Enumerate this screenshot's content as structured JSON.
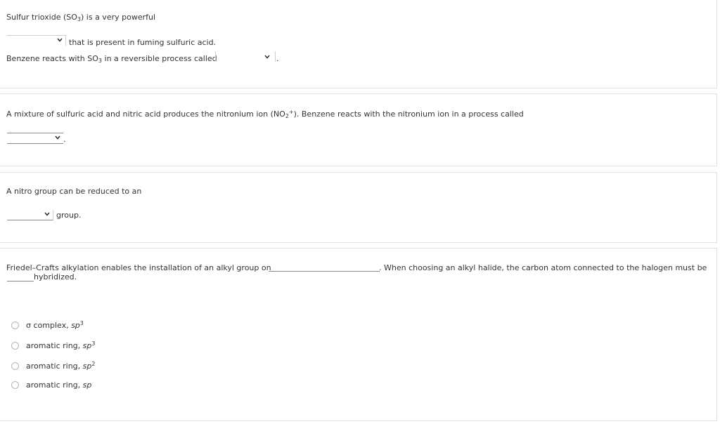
{
  "q1": {
    "line1_text": "Sulfur trioxide (SO",
    "line1_sub": "3",
    "line1_tail": ") is a very powerful",
    "after_dropdown1": "that is present in fuming sulfuric acid.",
    "line3_pre": "Benzene reacts with SO",
    "line3_sub": "3",
    "line3_post": " in a reversible process called",
    "line3_end": "."
  },
  "q2": {
    "text_pre": "A mixture of sulfuric acid and nitric acid produces the nitronium ion (NO",
    "text_sub": "2",
    "text_sup": "+",
    "text_post": "). Benzene reacts with the nitronium ion in a process called",
    "end_period": "."
  },
  "q3": {
    "text": "A nitro group can be reduced to an",
    "after_dropdown": "group."
  },
  "q4": {
    "text_pre": "Friedel–Crafts alkylation enables the installation of an alkyl group on",
    "text_mid": ". When choosing an alkyl halide, the carbon atom connected to the halogen must be",
    "text_end": "hybridized.",
    "options": [
      {
        "prefix": "σ complex, ",
        "hyb": "sp",
        "sup": "3"
      },
      {
        "prefix": "aromatic ring, ",
        "hyb": "sp",
        "sup": "3"
      },
      {
        "prefix": "aromatic ring, ",
        "hyb": "sp",
        "sup": "2"
      },
      {
        "prefix": "aromatic ring, ",
        "hyb": "sp",
        "sup": ""
      }
    ]
  },
  "colors": {
    "text": "#333333",
    "border": "#dde3ea",
    "underline": "#8a8a8a"
  }
}
